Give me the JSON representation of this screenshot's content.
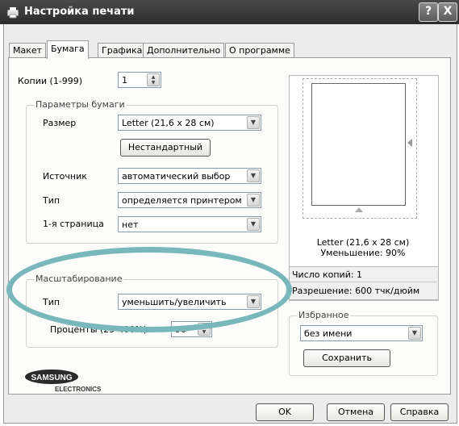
{
  "window": {
    "title": "Настройка печати",
    "help_btn": "?",
    "close_btn": "X"
  },
  "tabs": [
    "Макет",
    "Бумага",
    "Графика",
    "Дополнительно",
    "О программе"
  ],
  "copies": {
    "label": "Копии (1-999)",
    "value": "1"
  },
  "paper": {
    "legend": "Параметры бумаги",
    "size_label": "Размер",
    "size_value": "Letter (21,6 x 28 см)",
    "custom_button": "Нестандартный",
    "source_label": "Источник",
    "source_value": "автоматический выбор",
    "type_label": "Тип",
    "type_value": "определяется принтером",
    "first_page_label": "1-я страница",
    "first_page_value": "нет"
  },
  "scaling": {
    "legend": "Масштабирование",
    "type_label": "Тип",
    "type_value": "уменьшить/увеличить",
    "percent_label": "Проценты (25-400%)",
    "percent_value": "90"
  },
  "preview": {
    "paper_caption": "Letter (21,6 x 28 см)",
    "reduction_caption": "Уменьшение: 90%",
    "copies_info": "Число копий: 1",
    "resolution_info": "Разрешение: 600 тчк/дюйм"
  },
  "favorites": {
    "legend": "Избранное",
    "value": "без имени",
    "save_button": "Сохранить"
  },
  "logo": {
    "brand": "SAMSUNG",
    "sub": "ELECTRONICS"
  },
  "footer": {
    "ok": "OK",
    "cancel": "Отмена",
    "help": "Справка"
  },
  "colors": {
    "highlight_ellipse": "#78b8bc",
    "titlebar": "#3a3a3a"
  }
}
